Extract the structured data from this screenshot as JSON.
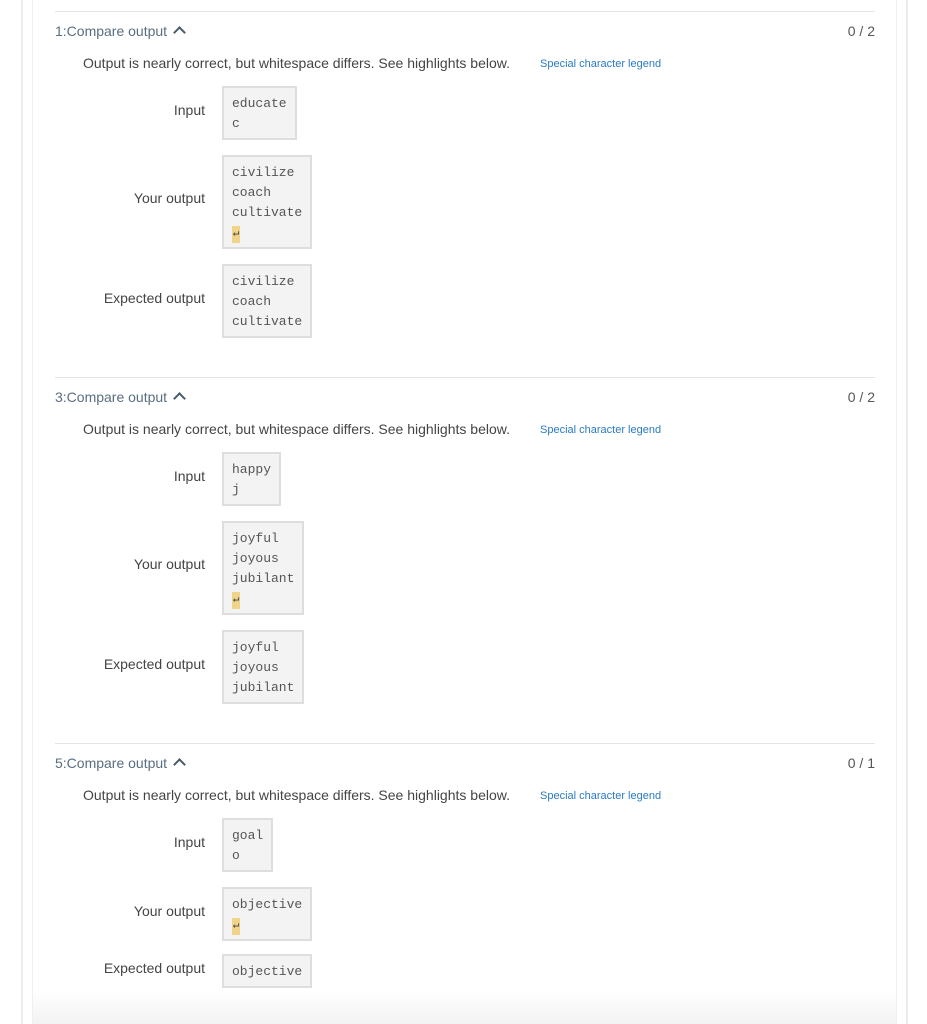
{
  "sections": [
    {
      "title": "1:Compare output",
      "score": "0 / 2",
      "message": "Output is nearly correct, but whitespace differs. See highlights below.",
      "legend_link": "Special character legend",
      "labels": {
        "input": "Input",
        "your_output": "Your output",
        "expected_output": "Expected output"
      },
      "input": [
        "educate",
        "c"
      ],
      "your_output": [
        "civilize",
        "coach",
        "cultivate"
      ],
      "expected_output": [
        "civilize",
        "coach",
        "cultivate"
      ]
    },
    {
      "title": "3:Compare output",
      "score": "0 / 2",
      "message": "Output is nearly correct, but whitespace differs. See highlights below.",
      "legend_link": "Special character legend",
      "labels": {
        "input": "Input",
        "your_output": "Your output",
        "expected_output": "Expected output"
      },
      "input": [
        "happy",
        "j"
      ],
      "your_output": [
        "joyful",
        "joyous",
        "jubilant"
      ],
      "expected_output": [
        "joyful",
        "joyous",
        "jubilant"
      ]
    },
    {
      "title": "5:Compare output",
      "score": "0 / 1",
      "message": "Output is nearly correct, but whitespace differs. See highlights below.",
      "legend_link": "Special character legend",
      "labels": {
        "input": "Input",
        "your_output": "Your output",
        "expected_output": "Expected output"
      },
      "input": [
        "goal",
        "o"
      ],
      "your_output": [
        "objective"
      ],
      "expected_output": [
        "objective"
      ]
    }
  ],
  "newline_marker": "↵",
  "colors": {
    "link": "#2a7bc4",
    "highlight": "#f0d48a",
    "box_bg": "#f3f3f3"
  }
}
